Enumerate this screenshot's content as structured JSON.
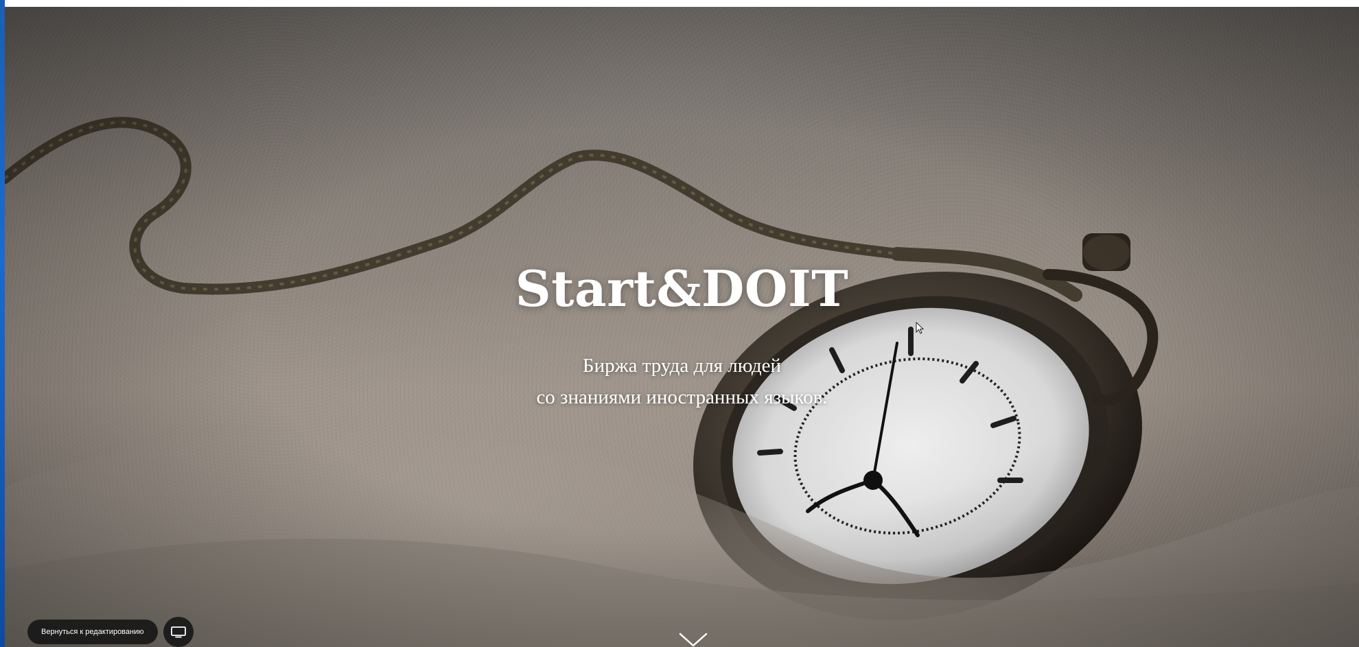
{
  "hero": {
    "title": "Start&DOIT",
    "subtitle_line1": "Биржа труда для людей",
    "subtitle_line2": "со знаниями иностранных языков."
  },
  "editor": {
    "back_label": "Вернуться к редактированию"
  },
  "icons": {
    "scroll": "chevron-down-icon",
    "device": "monitor-icon"
  },
  "colors": {
    "text": "#ffffff",
    "button_bg": "#141414"
  }
}
